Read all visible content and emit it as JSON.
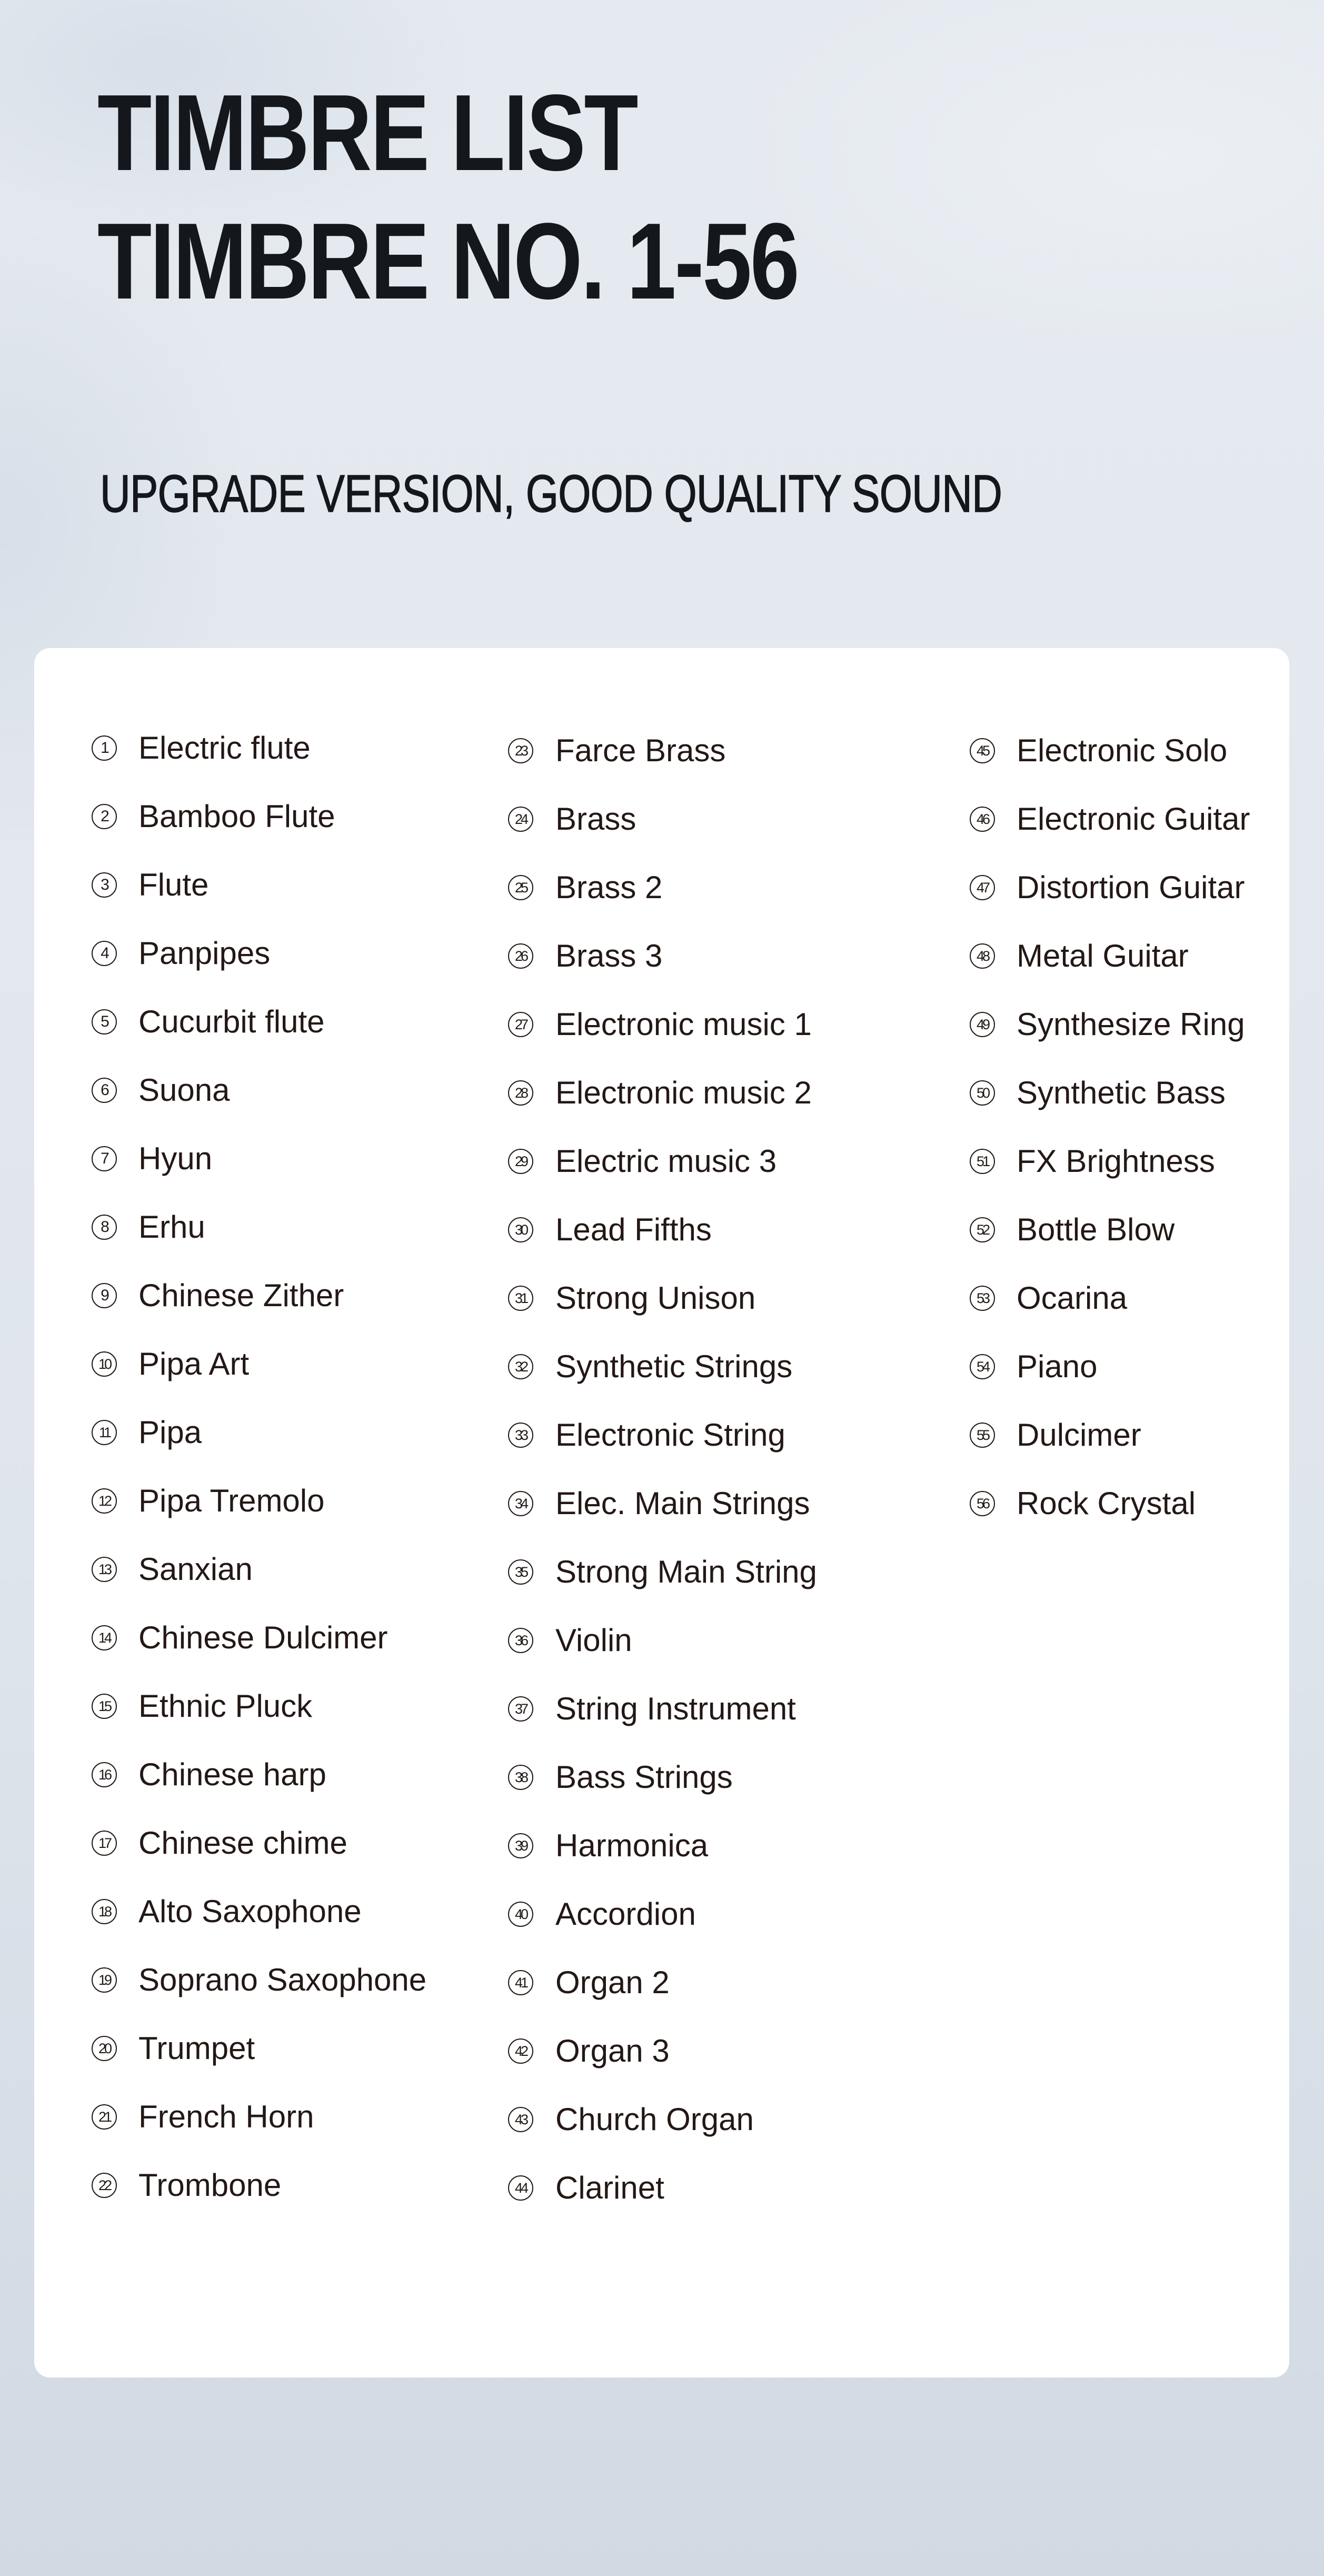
{
  "header": {
    "title_line_1": "TIMBRE LIST",
    "title_line_2": "TIMBRE NO. 1-56",
    "subtitle": "UPGRADE VERSION, GOOD QUALITY SOUND"
  },
  "colors": {
    "title_text": "#14171c",
    "list_text": "#231815",
    "card_background": "#ffffff",
    "page_background_top": "#e4e9ef",
    "page_background_bottom": "#d1d9e3"
  },
  "timbre_list": {
    "columns": [
      {
        "items": [
          {
            "number": "1",
            "name": "Electric flute"
          },
          {
            "number": "2",
            "name": "Bamboo Flute"
          },
          {
            "number": "3",
            "name": "Flute"
          },
          {
            "number": "4",
            "name": "Panpipes"
          },
          {
            "number": "5",
            "name": "Cucurbit flute"
          },
          {
            "number": "6",
            "name": "Suona"
          },
          {
            "number": "7",
            "name": "Hyun"
          },
          {
            "number": "8",
            "name": "Erhu"
          },
          {
            "number": "9",
            "name": "Chinese Zither"
          },
          {
            "number": "10",
            "name": "Pipa Art"
          },
          {
            "number": "11",
            "name": "Pipa"
          },
          {
            "number": "12",
            "name": "Pipa Tremolo"
          },
          {
            "number": "13",
            "name": "Sanxian"
          },
          {
            "number": "14",
            "name": "Chinese Dulcimer"
          },
          {
            "number": "15",
            "name": "Ethnic Pluck"
          },
          {
            "number": "16",
            "name": "Chinese harp"
          },
          {
            "number": "17",
            "name": "Chinese chime"
          },
          {
            "number": "18",
            "name": "Alto Saxophone"
          },
          {
            "number": "19",
            "name": "Soprano Saxophone"
          },
          {
            "number": "20",
            "name": "Trumpet"
          },
          {
            "number": "21",
            "name": "French Horn"
          },
          {
            "number": "22",
            "name": "Trombone"
          }
        ]
      },
      {
        "items": [
          {
            "number": "23",
            "name": "Farce Brass"
          },
          {
            "number": "24",
            "name": "Brass"
          },
          {
            "number": "25",
            "name": "Brass 2"
          },
          {
            "number": "26",
            "name": "Brass 3"
          },
          {
            "number": "27",
            "name": "Electronic music 1"
          },
          {
            "number": "28",
            "name": "Electronic music 2"
          },
          {
            "number": "29",
            "name": "Electric music 3"
          },
          {
            "number": "30",
            "name": "Lead Fifths"
          },
          {
            "number": "31",
            "name": "Strong Unison"
          },
          {
            "number": "32",
            "name": "Synthetic Strings"
          },
          {
            "number": "33",
            "name": "Electronic String"
          },
          {
            "number": "34",
            "name": "Elec. Main Strings"
          },
          {
            "number": "35",
            "name": "Strong Main String"
          },
          {
            "number": "36",
            "name": "Violin"
          },
          {
            "number": "37",
            "name": "String Instrument"
          },
          {
            "number": "38",
            "name": "Bass Strings"
          },
          {
            "number": "39",
            "name": "Harmonica"
          },
          {
            "number": "40",
            "name": "Accordion"
          },
          {
            "number": "41",
            "name": "Organ 2"
          },
          {
            "number": "42",
            "name": "Organ 3"
          },
          {
            "number": "43",
            "name": "Church Organ"
          },
          {
            "number": "44",
            "name": "Clarinet"
          }
        ]
      },
      {
        "items": [
          {
            "number": "45",
            "name": "Electronic Solo"
          },
          {
            "number": "46",
            "name": "Electronic Guitar"
          },
          {
            "number": "47",
            "name": "Distortion Guitar"
          },
          {
            "number": "48",
            "name": "Metal Guitar"
          },
          {
            "number": "49",
            "name": "Synthesize Ring"
          },
          {
            "number": "50",
            "name": "Synthetic Bass"
          },
          {
            "number": "51",
            "name": "FX Brightness"
          },
          {
            "number": "52",
            "name": "Bottle Blow"
          },
          {
            "number": "53",
            "name": "Ocarina"
          },
          {
            "number": "54",
            "name": "Piano"
          },
          {
            "number": "55",
            "name": "Dulcimer"
          },
          {
            "number": "56",
            "name": "Rock Crystal"
          }
        ]
      }
    ]
  }
}
